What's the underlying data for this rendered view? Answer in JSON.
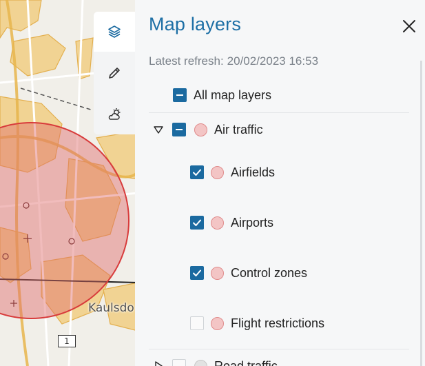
{
  "map": {
    "place_label": "Kaulsdo",
    "road_badge": "1",
    "colors": {
      "zone_fill": "#e06a6a",
      "zone_stroke": "#d83b3b",
      "urban": "#f0c36a",
      "land": "#f1efe9"
    }
  },
  "toolbar": {
    "items": [
      {
        "icon": "layers-icon",
        "active": true
      },
      {
        "icon": "pencil-icon",
        "active": false
      },
      {
        "icon": "weather-icon",
        "active": false
      }
    ]
  },
  "panel": {
    "title": "Map layers",
    "close_icon": "close-icon",
    "refresh_label": "Latest refresh:",
    "refresh_value": "20/02/2023 16:53",
    "all_layers": {
      "label": "All map layers",
      "state": "mixed"
    },
    "groups": [
      {
        "label": "Air traffic",
        "expanded": true,
        "state": "mixed",
        "color": "#f3c5c5",
        "children": [
          {
            "label": "Airfields",
            "checked": true
          },
          {
            "label": "Airports",
            "checked": true
          },
          {
            "label": "Control zones",
            "checked": true
          },
          {
            "label": "Flight restrictions",
            "checked": false
          }
        ]
      },
      {
        "label": "Road traffic",
        "expanded": false,
        "state": "unchecked",
        "color": "#e2e2e2"
      }
    ],
    "accent_color": "#1b6aa0",
    "title_color": "#1d6fa5"
  }
}
